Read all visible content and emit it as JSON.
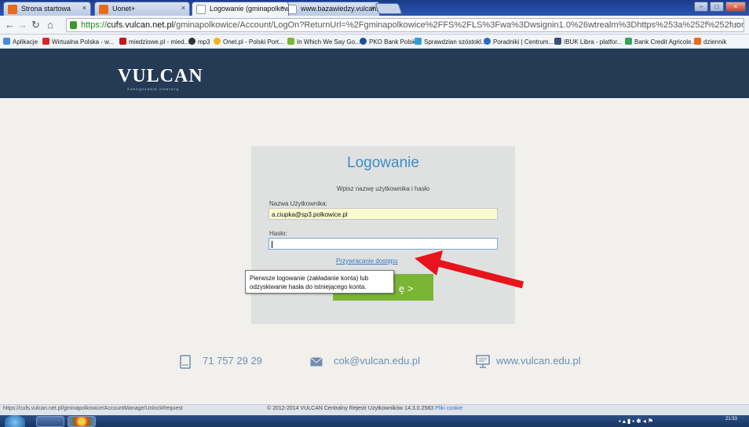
{
  "browser": {
    "tabs": [
      {
        "label": "Strona startowa",
        "icon": "orange-star-icon",
        "color": "#e86a1c"
      },
      {
        "label": "Uonet+",
        "icon": "orange-star-icon",
        "color": "#e86a1c"
      },
      {
        "label": "Logowanie (gminapolkow",
        "icon": "page-icon",
        "color": "#ffffff"
      },
      {
        "label": "www.bazawiedzy.vulcan.c",
        "icon": "page-icon",
        "color": "#ffffff"
      }
    ],
    "window_controls": [
      "–",
      "□",
      "×"
    ],
    "url_scheme": "https://",
    "url_host": "cufs.vulcan.net.pl",
    "url_path": "/gminapolkowice/Account/LogOn?ReturnUrl=%2Fgminapolkowice%2FFS%2FLS%3Fwa%3Dwsignin1.0%26wtrealm%3Dhttps%253a%252f%252fuonetplus.vulcan.net.pl%252fg",
    "bookmarks": [
      {
        "label": "Aplikacje",
        "color": "#4a8ad8"
      },
      {
        "label": "Wirtualna Polska - w...",
        "color": "#d8262a"
      },
      {
        "label": "miedziowe.pl - mied...",
        "color": "#c8171b"
      },
      {
        "label": "mp3",
        "color": "#333333"
      },
      {
        "label": "Onet.pl - Polski Port...",
        "color": "#f2b31a"
      },
      {
        "label": "In Which We Say Go...",
        "color": "#7ab535"
      },
      {
        "label": "PKO Bank Polski",
        "color": "#1a4f9c"
      },
      {
        "label": "Sprawdzian szóstokl...",
        "color": "#2ca0d8"
      },
      {
        "label": "Poradniki | Centrum...",
        "color": "#2a6ac8"
      },
      {
        "label": "IBUK Libra - platfor...",
        "color": "#3c4f7a"
      },
      {
        "label": "Bank Credit Agricole...",
        "color": "#3aa15a"
      },
      {
        "label": "dziennik",
        "color": "#e86a1c"
      }
    ],
    "status_url": "https://cufs.vulcan.net.pl/gminapolkowice/AccountManage/UnlockRequest"
  },
  "header": {
    "logo_text": "VULCAN",
    "logo_subtitle": "ZARZĄDZANIE OŚWIATĄ"
  },
  "login": {
    "title": "Logowanie",
    "subtitle": "Wpisz nazwę użytkownika i hasło",
    "username_label": "Nazwa Użytkownika:",
    "username_value": "a.ciupka@sp3.polkowice.pl",
    "password_label": "Hasło:",
    "password_value": "",
    "recover_link": "Przywracanie dostępu",
    "submit_label": "ę >",
    "tooltip": "Pierwsze logowanie (zakładanie konta) lub odzyskiwanie hasła do istniejącego konta."
  },
  "contact": {
    "phone": "71 757 29 29",
    "email": "cok@vulcan.edu.pl",
    "website": "www.vulcan.edu.pl"
  },
  "footer": {
    "copyright": "© 2012-2014 VULCAN Centralny Rejestr Użytkowników 14.3.0.2583",
    "cookie_link": "Pliki cookie"
  },
  "taskbar": {
    "clock": "21:53"
  },
  "colors": {
    "header_bg": "#243a55",
    "accent_blue": "#3b8dc6",
    "button_green": "#7ab535",
    "arrow_red": "#e8141b"
  }
}
